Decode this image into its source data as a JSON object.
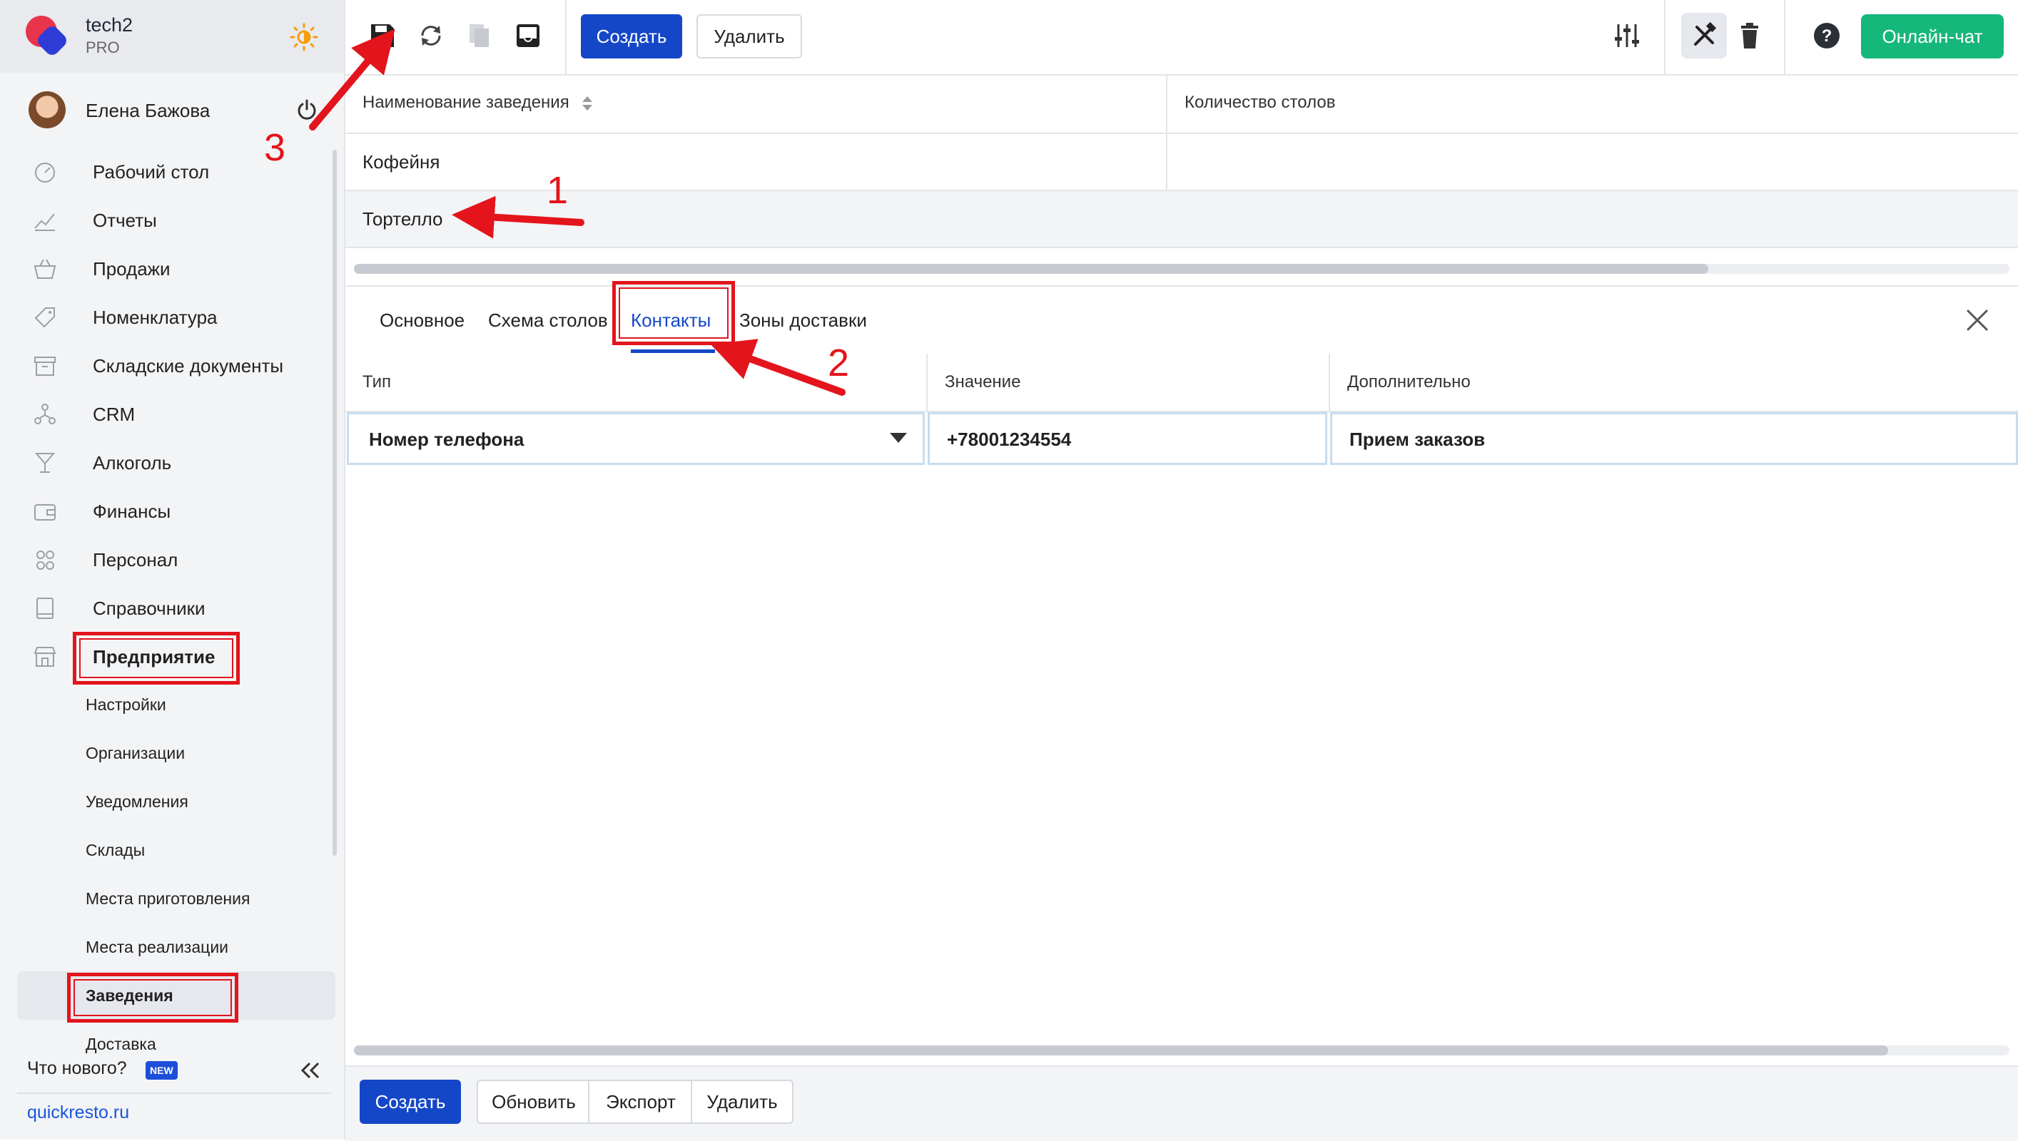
{
  "brand": {
    "name": "tech2",
    "plan": "PRO"
  },
  "user": {
    "name": "Елена Бажова"
  },
  "nav": [
    {
      "label": "Рабочий стол",
      "icon": "dashboard-icon"
    },
    {
      "label": "Отчеты",
      "icon": "reports-icon"
    },
    {
      "label": "Продажи",
      "icon": "basket-icon"
    },
    {
      "label": "Номенклатура",
      "icon": "tag-icon"
    },
    {
      "label": "Складские документы",
      "icon": "archive-icon"
    },
    {
      "label": "CRM",
      "icon": "crm-icon"
    },
    {
      "label": "Алкоголь",
      "icon": "glass-icon"
    },
    {
      "label": "Финансы",
      "icon": "wallet-icon"
    },
    {
      "label": "Персонал",
      "icon": "people-icon"
    },
    {
      "label": "Справочники",
      "icon": "book-icon"
    },
    {
      "label": "Предприятие",
      "icon": "store-icon"
    }
  ],
  "subnav": [
    "Настройки",
    "Организации",
    "Уведомления",
    "Склады",
    "Места приготовления",
    "Места реализации",
    "Заведения",
    "Доставка"
  ],
  "sidebar_footer": {
    "whats_new": "Что нового?",
    "new_badge": "NEW",
    "site": "quickresto.ru"
  },
  "toolbar": {
    "create": "Создать",
    "delete": "Удалить",
    "chat": "Онлайн-чат"
  },
  "grid": {
    "columns": [
      "Наименование заведения",
      "Количество столов"
    ],
    "rows": [
      {
        "name": "Кофейня",
        "tables": ""
      },
      {
        "name": "Тортелло",
        "tables": ""
      }
    ]
  },
  "tabs": [
    "Основное",
    "Схема столов",
    "Контакты",
    "Зоны доставки"
  ],
  "active_tab": "Контакты",
  "contacts": {
    "columns": [
      "Тип",
      "Значение",
      "Дополнительно"
    ],
    "row": {
      "type": "Номер телефона",
      "value": "+78001234554",
      "extra": "Прием заказов"
    }
  },
  "footer": {
    "create": "Создать",
    "refresh": "Обновить",
    "export": "Экспорт",
    "delete": "Удалить"
  },
  "annotations": [
    "1",
    "2",
    "3"
  ],
  "colors": {
    "accent": "#1447c8",
    "chat": "#16b77a",
    "annotation": "#e3141b",
    "brand_red": "#e8344a",
    "brand_blue": "#2f3bd6"
  }
}
